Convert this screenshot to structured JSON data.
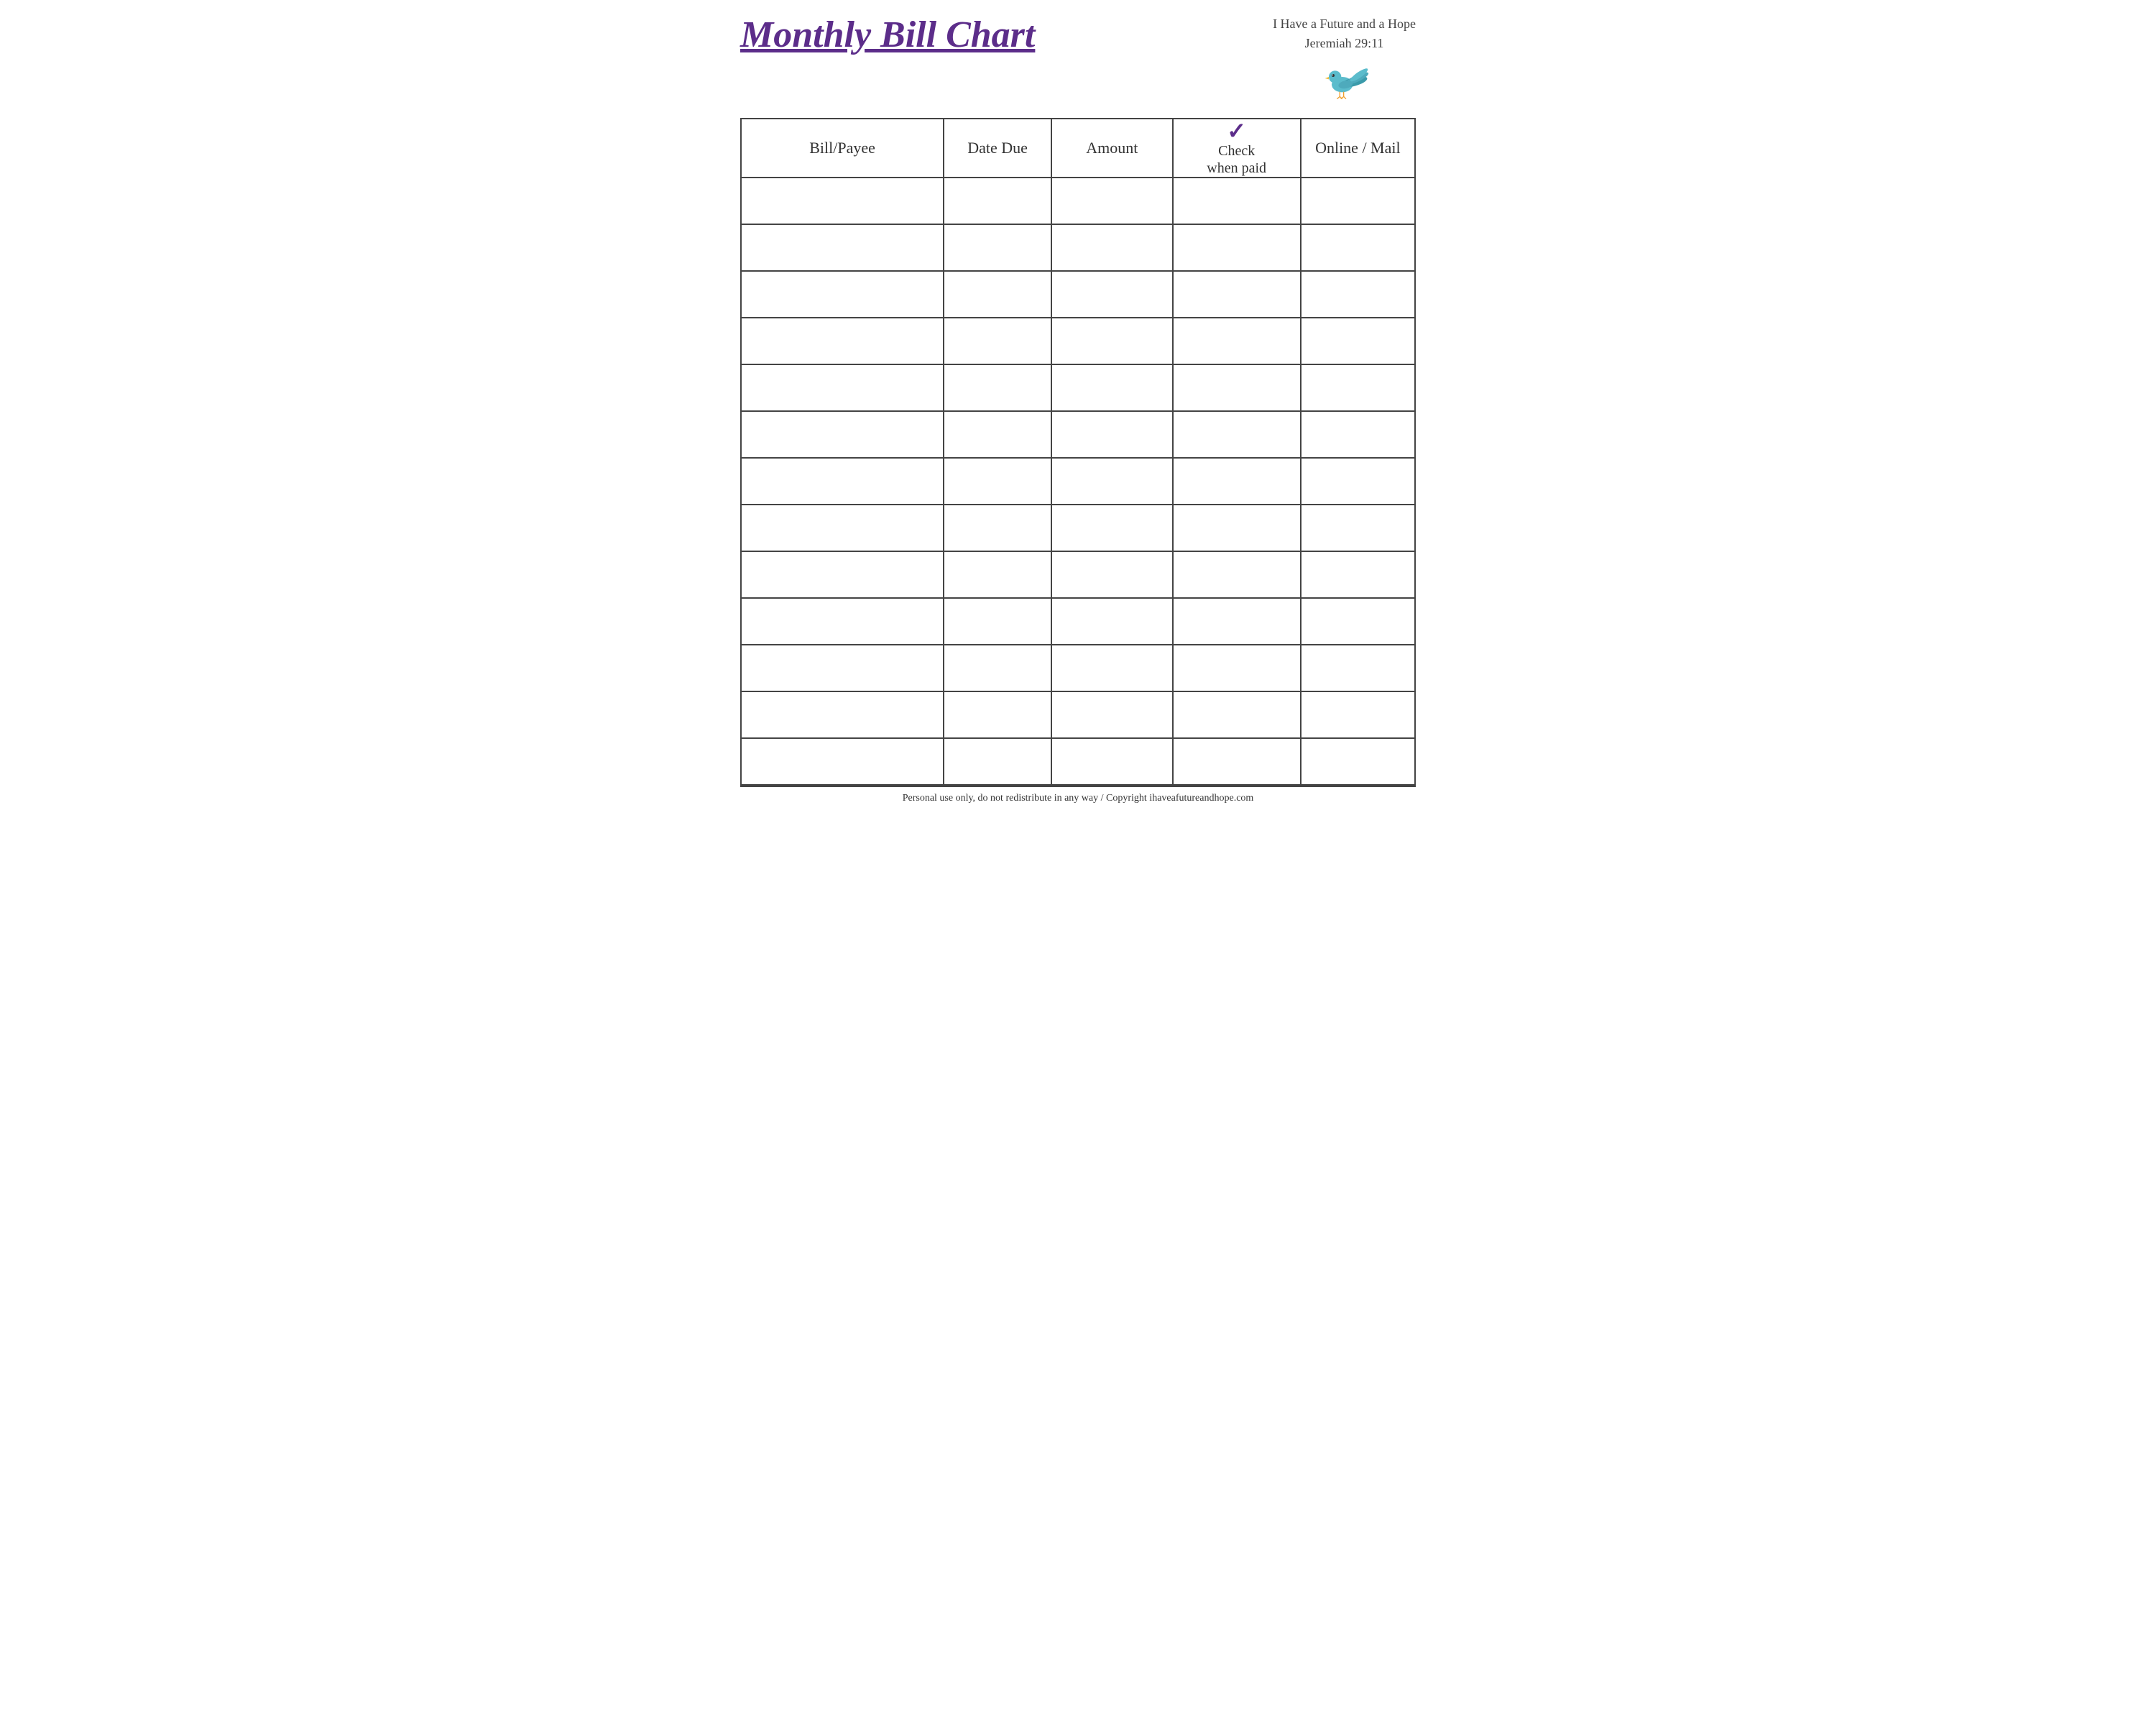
{
  "header": {
    "title": "Monthly Bill Chart",
    "subtitle_line1": "I Have a Future and a Hope",
    "subtitle_line2": "Jeremiah 29:11"
  },
  "table": {
    "columns": [
      {
        "id": "bill",
        "label": "Bill/Payee"
      },
      {
        "id": "date",
        "label": "Date Due"
      },
      {
        "id": "amount",
        "label": "Amount"
      },
      {
        "id": "check",
        "label_line1": "Check",
        "label_line2": "when paid",
        "check_mark": "✓"
      },
      {
        "id": "online",
        "label": "Online / Mail"
      }
    ],
    "row_count": 13
  },
  "footer": {
    "text": "Personal use only, do not redistribute in any way / Copyright ihaveafutureandhope.com"
  }
}
